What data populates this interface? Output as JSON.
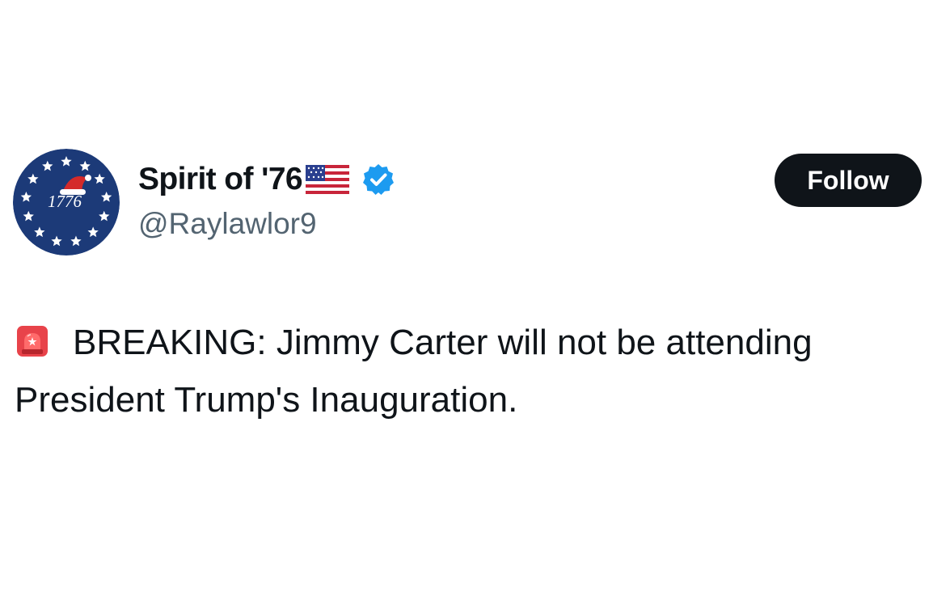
{
  "tweet": {
    "author": {
      "display_name": "Spirit of '76",
      "handle": "@Raylawlor9",
      "avatar": {
        "year_text": "1776",
        "colors": {
          "background": "#1c3a78",
          "stars": "#ffffff",
          "hat": "#d42a2a"
        }
      },
      "name_emoji": "us-flag-icon",
      "verified": true,
      "verified_color": "#1d9bf0"
    },
    "follow_label": "Follow",
    "text_emoji": "siren-icon",
    "text": "BREAKING: Jimmy Carter will not be attending President Trump's Inauguration."
  },
  "colors": {
    "text": "#0f1419",
    "secondary_text": "#536471",
    "button_bg": "#0f1419",
    "button_text": "#ffffff",
    "background": "#ffffff"
  }
}
